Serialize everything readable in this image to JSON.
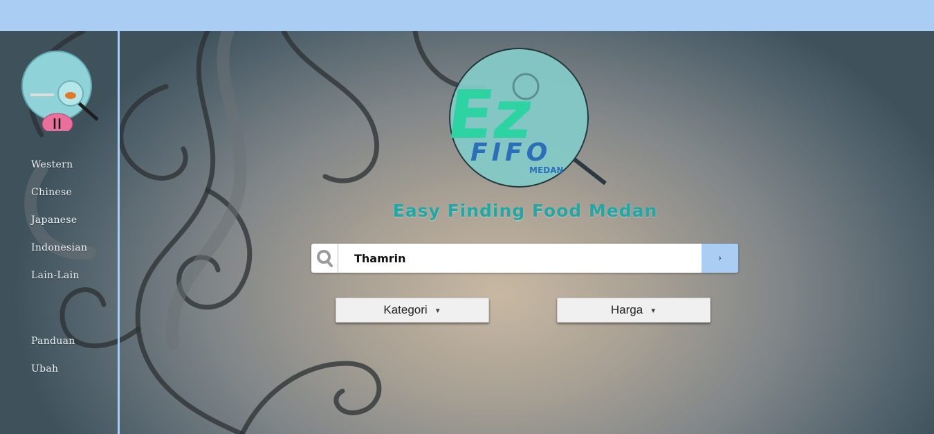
{
  "sidebar": {
    "categories": [
      "Western",
      "Chinese",
      "Japanese",
      "Indonesian",
      "Lain-Lain"
    ],
    "links": [
      "Panduan",
      "Ubah"
    ]
  },
  "logo": {
    "text_main": "Ez",
    "text_sub": "FIFO",
    "text_city": "MEDAN"
  },
  "header": {
    "tagline": "Easy Finding Food Medan"
  },
  "search": {
    "value": "Thamrin",
    "submit_glyph": "›"
  },
  "filters": {
    "kategori_label": "Kategori",
    "harga_label": "Harga",
    "caret": "▼"
  },
  "colors": {
    "accent": "#a9cdf3",
    "tagline": "#1fa8a6",
    "logo_green": "#2ed3a4",
    "logo_blue": "#2a6fb8"
  }
}
